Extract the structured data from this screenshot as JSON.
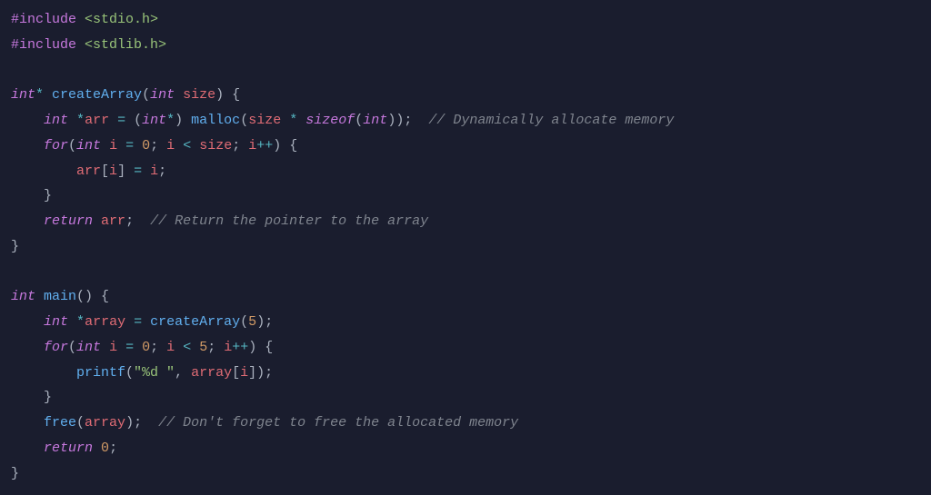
{
  "code": {
    "lines": [
      {
        "indent": "",
        "tokens": [
          {
            "cls": "pp",
            "t": "#include"
          },
          {
            "cls": "pl",
            "t": " "
          },
          {
            "cls": "hdr",
            "t": "<stdio.h>"
          }
        ]
      },
      {
        "indent": "",
        "tokens": [
          {
            "cls": "pp",
            "t": "#include"
          },
          {
            "cls": "pl",
            "t": " "
          },
          {
            "cls": "hdr",
            "t": "<stdlib.h>"
          }
        ]
      },
      {
        "indent": "",
        "tokens": []
      },
      {
        "indent": "",
        "tokens": [
          {
            "cls": "kw",
            "t": "int"
          },
          {
            "cls": "op",
            "t": "*"
          },
          {
            "cls": "pl",
            "t": " "
          },
          {
            "cls": "fn",
            "t": "createArray"
          },
          {
            "cls": "pl",
            "t": "("
          },
          {
            "cls": "kw",
            "t": "int"
          },
          {
            "cls": "pl",
            "t": " "
          },
          {
            "cls": "var",
            "t": "size"
          },
          {
            "cls": "pl",
            "t": ") {"
          }
        ]
      },
      {
        "indent": "    ",
        "tokens": [
          {
            "cls": "kw",
            "t": "int"
          },
          {
            "cls": "pl",
            "t": " "
          },
          {
            "cls": "op",
            "t": "*"
          },
          {
            "cls": "var",
            "t": "arr"
          },
          {
            "cls": "pl",
            "t": " "
          },
          {
            "cls": "op",
            "t": "="
          },
          {
            "cls": "pl",
            "t": " ("
          },
          {
            "cls": "kw",
            "t": "int"
          },
          {
            "cls": "op",
            "t": "*"
          },
          {
            "cls": "pl",
            "t": ") "
          },
          {
            "cls": "fn",
            "t": "malloc"
          },
          {
            "cls": "pl",
            "t": "("
          },
          {
            "cls": "var",
            "t": "size"
          },
          {
            "cls": "pl",
            "t": " "
          },
          {
            "cls": "op",
            "t": "*"
          },
          {
            "cls": "pl",
            "t": " "
          },
          {
            "cls": "kw",
            "t": "sizeof"
          },
          {
            "cls": "pl",
            "t": "("
          },
          {
            "cls": "kw",
            "t": "int"
          },
          {
            "cls": "pl",
            "t": "));  "
          },
          {
            "cls": "cmt",
            "t": "// Dynamically allocate memory"
          }
        ]
      },
      {
        "indent": "    ",
        "tokens": [
          {
            "cls": "kw",
            "t": "for"
          },
          {
            "cls": "pl",
            "t": "("
          },
          {
            "cls": "kw",
            "t": "int"
          },
          {
            "cls": "pl",
            "t": " "
          },
          {
            "cls": "var",
            "t": "i"
          },
          {
            "cls": "pl",
            "t": " "
          },
          {
            "cls": "op",
            "t": "="
          },
          {
            "cls": "pl",
            "t": " "
          },
          {
            "cls": "num",
            "t": "0"
          },
          {
            "cls": "pl",
            "t": "; "
          },
          {
            "cls": "var",
            "t": "i"
          },
          {
            "cls": "pl",
            "t": " "
          },
          {
            "cls": "op",
            "t": "<"
          },
          {
            "cls": "pl",
            "t": " "
          },
          {
            "cls": "var",
            "t": "size"
          },
          {
            "cls": "pl",
            "t": "; "
          },
          {
            "cls": "var",
            "t": "i"
          },
          {
            "cls": "op",
            "t": "++"
          },
          {
            "cls": "pl",
            "t": ") {"
          }
        ]
      },
      {
        "indent": "        ",
        "tokens": [
          {
            "cls": "var",
            "t": "arr"
          },
          {
            "cls": "pl",
            "t": "["
          },
          {
            "cls": "var",
            "t": "i"
          },
          {
            "cls": "pl",
            "t": "] "
          },
          {
            "cls": "op",
            "t": "="
          },
          {
            "cls": "pl",
            "t": " "
          },
          {
            "cls": "var",
            "t": "i"
          },
          {
            "cls": "pl",
            "t": ";"
          }
        ]
      },
      {
        "indent": "    ",
        "tokens": [
          {
            "cls": "pl",
            "t": "}"
          }
        ]
      },
      {
        "indent": "    ",
        "tokens": [
          {
            "cls": "kw",
            "t": "return"
          },
          {
            "cls": "pl",
            "t": " "
          },
          {
            "cls": "var",
            "t": "arr"
          },
          {
            "cls": "pl",
            "t": ";  "
          },
          {
            "cls": "cmt",
            "t": "// Return the pointer to the array"
          }
        ]
      },
      {
        "indent": "",
        "tokens": [
          {
            "cls": "pl",
            "t": "}"
          }
        ]
      },
      {
        "indent": "",
        "tokens": []
      },
      {
        "indent": "",
        "tokens": [
          {
            "cls": "kw",
            "t": "int"
          },
          {
            "cls": "pl",
            "t": " "
          },
          {
            "cls": "fn",
            "t": "main"
          },
          {
            "cls": "pl",
            "t": "() {"
          }
        ]
      },
      {
        "indent": "    ",
        "tokens": [
          {
            "cls": "kw",
            "t": "int"
          },
          {
            "cls": "pl",
            "t": " "
          },
          {
            "cls": "op",
            "t": "*"
          },
          {
            "cls": "var",
            "t": "array"
          },
          {
            "cls": "pl",
            "t": " "
          },
          {
            "cls": "op",
            "t": "="
          },
          {
            "cls": "pl",
            "t": " "
          },
          {
            "cls": "fn",
            "t": "createArray"
          },
          {
            "cls": "pl",
            "t": "("
          },
          {
            "cls": "num",
            "t": "5"
          },
          {
            "cls": "pl",
            "t": ");"
          }
        ]
      },
      {
        "indent": "    ",
        "tokens": [
          {
            "cls": "kw",
            "t": "for"
          },
          {
            "cls": "pl",
            "t": "("
          },
          {
            "cls": "kw",
            "t": "int"
          },
          {
            "cls": "pl",
            "t": " "
          },
          {
            "cls": "var",
            "t": "i"
          },
          {
            "cls": "pl",
            "t": " "
          },
          {
            "cls": "op",
            "t": "="
          },
          {
            "cls": "pl",
            "t": " "
          },
          {
            "cls": "num",
            "t": "0"
          },
          {
            "cls": "pl",
            "t": "; "
          },
          {
            "cls": "var",
            "t": "i"
          },
          {
            "cls": "pl",
            "t": " "
          },
          {
            "cls": "op",
            "t": "<"
          },
          {
            "cls": "pl",
            "t": " "
          },
          {
            "cls": "num",
            "t": "5"
          },
          {
            "cls": "pl",
            "t": "; "
          },
          {
            "cls": "var",
            "t": "i"
          },
          {
            "cls": "op",
            "t": "++"
          },
          {
            "cls": "pl",
            "t": ") {"
          }
        ]
      },
      {
        "indent": "        ",
        "tokens": [
          {
            "cls": "fn",
            "t": "printf"
          },
          {
            "cls": "pl",
            "t": "("
          },
          {
            "cls": "str",
            "t": "\"%d \""
          },
          {
            "cls": "pl",
            "t": ", "
          },
          {
            "cls": "var",
            "t": "array"
          },
          {
            "cls": "pl",
            "t": "["
          },
          {
            "cls": "var",
            "t": "i"
          },
          {
            "cls": "pl",
            "t": "]);"
          }
        ]
      },
      {
        "indent": "    ",
        "tokens": [
          {
            "cls": "pl",
            "t": "}"
          }
        ]
      },
      {
        "indent": "    ",
        "tokens": [
          {
            "cls": "fn",
            "t": "free"
          },
          {
            "cls": "pl",
            "t": "("
          },
          {
            "cls": "var",
            "t": "array"
          },
          {
            "cls": "pl",
            "t": ");  "
          },
          {
            "cls": "cmt",
            "t": "// Don't forget to free the allocated memory"
          }
        ]
      },
      {
        "indent": "    ",
        "tokens": [
          {
            "cls": "kw",
            "t": "return"
          },
          {
            "cls": "pl",
            "t": " "
          },
          {
            "cls": "num",
            "t": "0"
          },
          {
            "cls": "pl",
            "t": ";"
          }
        ]
      },
      {
        "indent": "",
        "tokens": [
          {
            "cls": "pl",
            "t": "}"
          }
        ]
      }
    ]
  }
}
